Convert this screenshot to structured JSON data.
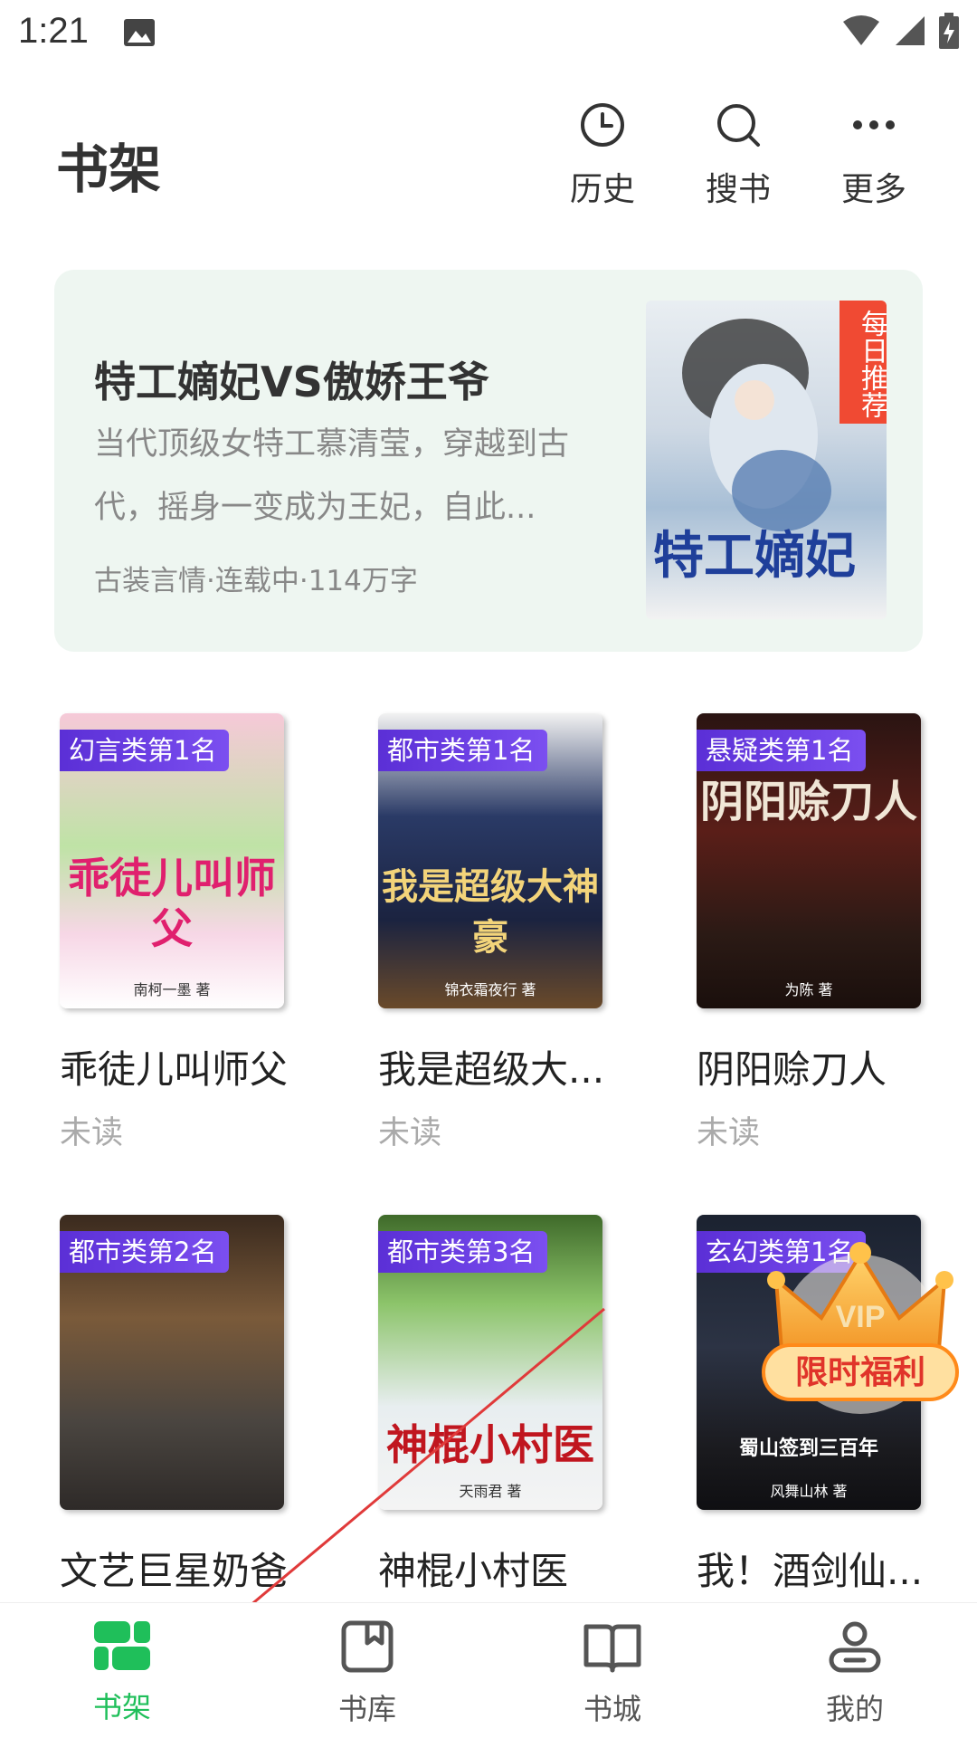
{
  "status_bar": {
    "time": "1:21"
  },
  "header": {
    "title": "书架",
    "history_label": "历史",
    "search_label": "搜书",
    "more_label": "更多"
  },
  "banner": {
    "title": "特工嫡妃VS傲娇王爷",
    "description": "当代顶级女特工慕清莹，穿越到古代，摇身一变成为王妃，自此...",
    "meta": "古装言情·连载中·114万字",
    "tag": "每日推荐",
    "cover_title": "特工嫡妃"
  },
  "books": [
    {
      "rank": "幻言类第1名",
      "name": "乖徒儿叫师父",
      "status": "未读",
      "cover_title": "乖徒儿叫师父",
      "cover_author": "南柯一墨 著"
    },
    {
      "rank": "都市类第1名",
      "name": "我是超级大...",
      "status": "未读",
      "cover_title": "我是超级大神豪",
      "cover_author": "锦衣霜夜行 著"
    },
    {
      "rank": "悬疑类第1名",
      "name": "阴阳赊刀人",
      "status": "未读",
      "cover_title": "阴阳赊刀人",
      "cover_author": "为陈 著"
    },
    {
      "rank": "都市类第2名",
      "name": "文艺巨星奶爸",
      "status": "",
      "cover_title": "",
      "cover_author": ""
    },
    {
      "rank": "都市类第3名",
      "name": "神棍小村医",
      "status": "",
      "cover_title": "神棍小村医",
      "cover_author": "天雨君 著"
    },
    {
      "rank": "玄幻类第1名",
      "name": "我！酒剑仙...",
      "status": "",
      "cover_title": "蜀山签到三百年",
      "cover_author": "风舞山林 著"
    }
  ],
  "promo": {
    "label": "限时福利",
    "badge": "VIP"
  },
  "nav": {
    "items": [
      {
        "label": "书架"
      },
      {
        "label": "书库"
      },
      {
        "label": "书城"
      },
      {
        "label": "我的"
      }
    ]
  },
  "colors": {
    "accent": "#1fbf5a",
    "rank_badge": "#6a3fe6",
    "banner_bg": "#eef6f1"
  }
}
